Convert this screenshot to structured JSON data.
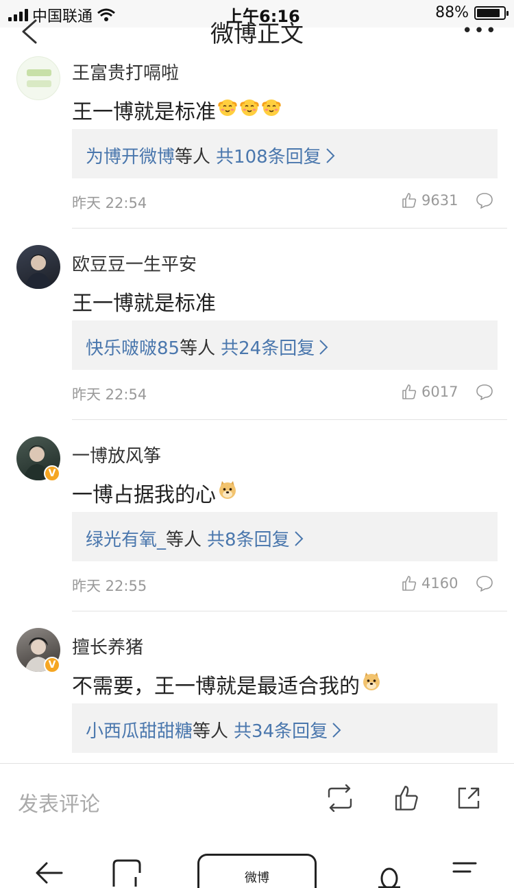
{
  "status": {
    "carrier": "中国联通",
    "time": "上午6:16",
    "battery": "88%",
    "battery_level": 0.88
  },
  "nav": {
    "title": "微博正文",
    "more": "•••"
  },
  "comments": [
    {
      "username": "王富贵打嗝啦",
      "text": "王一博就是标准",
      "emoji_count": 3,
      "emoji_name": "smile-blush-icon",
      "verified": false,
      "reply_user": "为博开微博",
      "reply_mid": "等人",
      "reply_count_text": "共108条回复",
      "time": "昨天 22:54",
      "likes": "9631"
    },
    {
      "username": "欧豆豆一生平安",
      "text": "王一博就是标准",
      "emoji_count": 0,
      "verified": false,
      "reply_user": "快乐啵啵85",
      "reply_mid": "等人",
      "reply_count_text": "共24条回复",
      "time": "昨天 22:54",
      "likes": "6017"
    },
    {
      "username": "一博放风筝",
      "text": "一博占据我的心",
      "emoji_count": 1,
      "emoji_name": "doge-icon",
      "verified": true,
      "reply_user": "绿光有氧_",
      "reply_mid": "等人",
      "reply_count_text": "共8条回复",
      "time": "昨天 22:55",
      "likes": "4160"
    },
    {
      "username": "擅长养猪",
      "text": "不需要，王一博就是最适合我的",
      "emoji_count": 1,
      "emoji_name": "doge-icon",
      "verified": true,
      "reply_user": "小西瓜甜甜糖",
      "reply_mid": "等人",
      "reply_count_text": "共34条回复",
      "time": "",
      "likes": ""
    }
  ],
  "verified_badge": "V",
  "actionbar": {
    "placeholder": "发表评论"
  },
  "browser": {
    "home_label": "微博"
  },
  "colors": {
    "link": "#4a77ad",
    "badge": "#f5a623",
    "reply_bg": "#f2f2f2"
  }
}
